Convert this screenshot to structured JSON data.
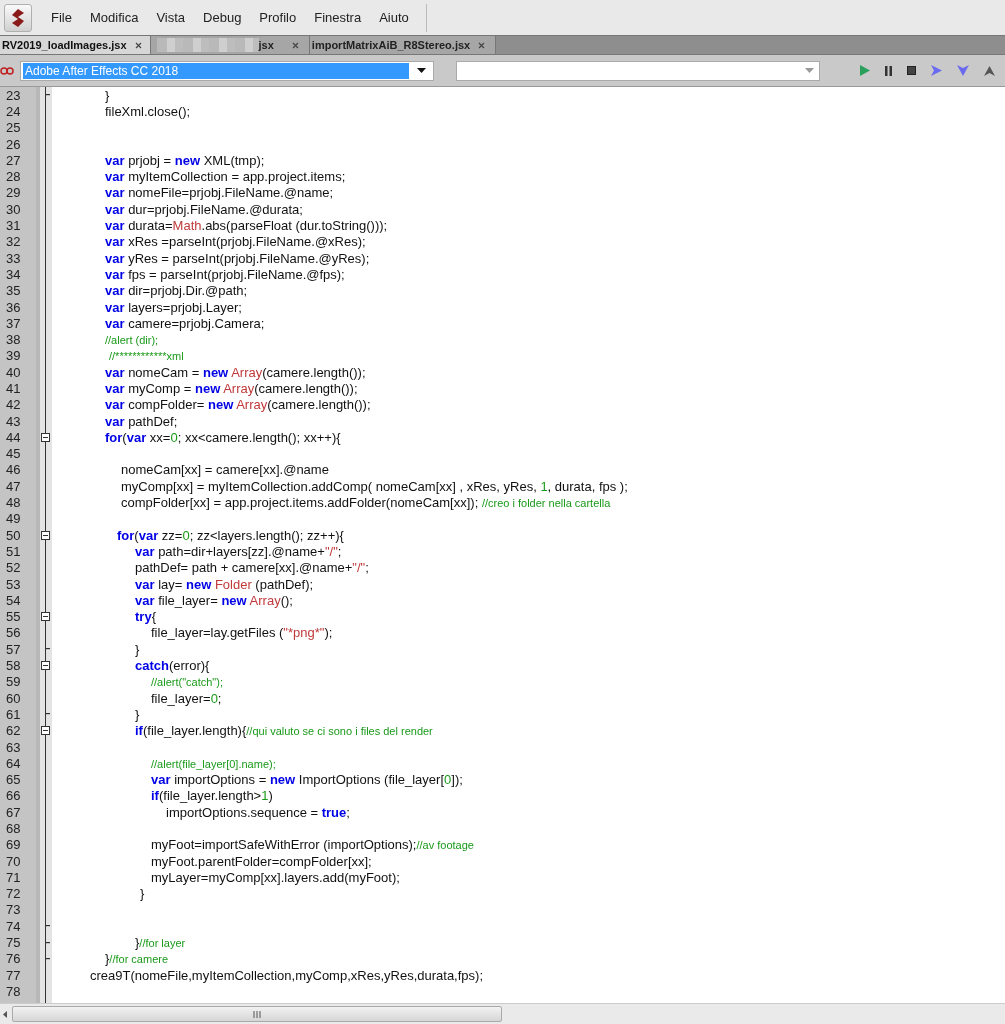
{
  "menu": [
    "File",
    "Modifica",
    "Vista",
    "Debug",
    "Profilo",
    "Finestra",
    "Aiuto"
  ],
  "tabs": [
    {
      "label": "RV2019_loadImages.jsx",
      "selected": true,
      "redacted": false
    },
    {
      "label": "jsx",
      "selected": false,
      "redacted": true
    },
    {
      "label": "importMatrixAiB_R8Stereo.jsx",
      "selected": false,
      "redacted": false
    }
  ],
  "target_select": {
    "value": "Adobe After Effects CC 2018"
  },
  "lines": [
    {
      "n": "23",
      "kind": "base",
      "collapsible": false,
      "block_end": true,
      "t": [
        {
          "kind": "p",
          "text": "}"
        }
      ]
    },
    {
      "n": "24",
      "kind": "base",
      "collapsible": false,
      "block_end": false,
      "t": [
        {
          "kind": "p",
          "text": "fileXml.close();"
        }
      ]
    },
    {
      "n": "25",
      "collapsible": false,
      "block_end": false
    },
    {
      "n": "26",
      "collapsible": false,
      "block_end": false
    },
    {
      "n": "27",
      "kind": "base",
      "collapsible": false,
      "block_end": false,
      "t": [
        {
          "kind": "kw",
          "text": "var"
        },
        {
          "kind": "p",
          "text": " prjobj = "
        },
        {
          "kind": "kw",
          "text": "new"
        },
        {
          "kind": "p",
          "text": " XML(tmp);"
        }
      ]
    },
    {
      "n": "28",
      "kind": "base",
      "collapsible": false,
      "block_end": false,
      "t": [
        {
          "kind": "kw",
          "text": "var"
        },
        {
          "kind": "p",
          "text": " myItemCollection = app.project.items;"
        }
      ]
    },
    {
      "n": "29",
      "kind": "base",
      "collapsible": false,
      "block_end": false,
      "t": [
        {
          "kind": "kw",
          "text": "var"
        },
        {
          "kind": "p",
          "text": " nomeFile=prjobj.FileName.@name;"
        }
      ]
    },
    {
      "n": "30",
      "kind": "base",
      "collapsible": false,
      "block_end": false,
      "t": [
        {
          "kind": "kw",
          "text": "var"
        },
        {
          "kind": "p",
          "text": " dur=prjobj.FileName.@durata;"
        }
      ]
    },
    {
      "n": "31",
      "kind": "base",
      "collapsible": false,
      "block_end": false,
      "t": [
        {
          "kind": "kw",
          "text": "var"
        },
        {
          "kind": "p",
          "text": " durata="
        },
        {
          "kind": "cls",
          "text": "Math"
        },
        {
          "kind": "p",
          "text": ".abs(parseFloat (dur.toString()));"
        }
      ]
    },
    {
      "n": "32",
      "kind": "base",
      "collapsible": false,
      "block_end": false,
      "t": [
        {
          "kind": "kw",
          "text": "var"
        },
        {
          "kind": "p",
          "text": " xRes =parseInt(prjobj.FileName.@xRes);"
        }
      ]
    },
    {
      "n": "33",
      "kind": "base",
      "collapsible": false,
      "block_end": false,
      "t": [
        {
          "kind": "kw",
          "text": "var"
        },
        {
          "kind": "p",
          "text": " yRes = parseInt(prjobj.FileName.@yRes);"
        }
      ]
    },
    {
      "n": "34",
      "kind": "base",
      "collapsible": false,
      "block_end": false,
      "t": [
        {
          "kind": "kw",
          "text": "var"
        },
        {
          "kind": "p",
          "text": " fps = parseInt(prjobj.FileName.@fps);"
        }
      ]
    },
    {
      "n": "35",
      "kind": "base",
      "collapsible": false,
      "block_end": false,
      "t": [
        {
          "kind": "kw",
          "text": "var"
        },
        {
          "kind": "p",
          "text": " dir=prjobj.Dir.@path;"
        }
      ]
    },
    {
      "n": "36",
      "kind": "base",
      "collapsible": false,
      "block_end": false,
      "t": [
        {
          "kind": "kw",
          "text": "var"
        },
        {
          "kind": "p",
          "text": " layers=prjobj.Layer;"
        }
      ]
    },
    {
      "n": "37",
      "kind": "base",
      "collapsible": false,
      "block_end": false,
      "t": [
        {
          "kind": "kw",
          "text": "var"
        },
        {
          "kind": "p",
          "text": " camere=prjobj.Camera;"
        }
      ]
    },
    {
      "n": "38",
      "kind": "base",
      "collapsible": false,
      "block_end": false,
      "t": [
        {
          "kind": "cm",
          "text": "//alert (dir);"
        }
      ]
    },
    {
      "n": "39",
      "kind": "baseplus",
      "collapsible": false,
      "block_end": false,
      "t": [
        {
          "kind": "cm",
          "text": "//************xml"
        }
      ]
    },
    {
      "n": "40",
      "kind": "base",
      "collapsible": false,
      "block_end": false,
      "t": [
        {
          "kind": "kw",
          "text": "var"
        },
        {
          "kind": "p",
          "text": " nomeCam = "
        },
        {
          "kind": "kw",
          "text": "new"
        },
        {
          "kind": "cls",
          "text": " Array"
        },
        {
          "kind": "p",
          "text": "(camere.length());"
        }
      ]
    },
    {
      "n": "41",
      "kind": "base",
      "collapsible": false,
      "block_end": false,
      "t": [
        {
          "kind": "kw",
          "text": "var"
        },
        {
          "kind": "p",
          "text": " myComp = "
        },
        {
          "kind": "kw",
          "text": "new"
        },
        {
          "kind": "cls",
          "text": " Array"
        },
        {
          "kind": "p",
          "text": "(camere.length());"
        }
      ]
    },
    {
      "n": "42",
      "kind": "base",
      "collapsible": false,
      "block_end": false,
      "t": [
        {
          "kind": "kw",
          "text": "var"
        },
        {
          "kind": "p",
          "text": " compFolder= "
        },
        {
          "kind": "kw",
          "text": "new"
        },
        {
          "kind": "cls",
          "text": " Array"
        },
        {
          "kind": "p",
          "text": "(camere.length());"
        }
      ]
    },
    {
      "n": "43",
      "kind": "base",
      "collapsible": false,
      "block_end": false,
      "t": [
        {
          "kind": "kw",
          "text": "var"
        },
        {
          "kind": "p",
          "text": " pathDef;"
        }
      ]
    },
    {
      "n": "44",
      "kind": "base",
      "collapsible": true,
      "block_end": false,
      "t": [
        {
          "kind": "kw",
          "text": "for"
        },
        {
          "kind": "p",
          "text": "("
        },
        {
          "kind": "kw",
          "text": "var"
        },
        {
          "kind": "p",
          "text": " xx="
        },
        {
          "kind": "num",
          "text": "0"
        },
        {
          "kind": "p",
          "text": "; xx<camere.length(); xx++){"
        }
      ]
    },
    {
      "n": "45",
      "collapsible": false,
      "block_end": false
    },
    {
      "n": "46",
      "kind": "loop",
      "collapsible": false,
      "block_end": false,
      "t": [
        {
          "kind": "p",
          "text": "nomeCam[xx] = camere[xx].@name"
        }
      ]
    },
    {
      "n": "47",
      "kind": "loop",
      "collapsible": false,
      "block_end": false,
      "t": [
        {
          "kind": "p",
          "text": "myComp[xx] = myItemCollection.addComp( nomeCam[xx] , xRes, yRes, "
        },
        {
          "kind": "num",
          "text": "1"
        },
        {
          "kind": "p",
          "text": ", durata, fps );"
        }
      ]
    },
    {
      "n": "48",
      "kind": "loop",
      "collapsible": false,
      "block_end": false,
      "t": [
        {
          "kind": "p",
          "text": "compFolder[xx] = app.project.items.addFolder(nomeCam[xx]); "
        },
        {
          "kind": "cm",
          "text": "//creo i folder nella cartella"
        }
      ]
    },
    {
      "n": "49",
      "collapsible": false,
      "block_end": false
    },
    {
      "n": "50",
      "kind": "loophead",
      "collapsible": true,
      "block_end": false,
      "t": [
        {
          "kind": "kw",
          "text": "for"
        },
        {
          "kind": "p",
          "text": "("
        },
        {
          "kind": "kw",
          "text": "var"
        },
        {
          "kind": "p",
          "text": " zz="
        },
        {
          "kind": "num",
          "text": "0"
        },
        {
          "kind": "p",
          "text": "; zz<layers.length(); zz++){"
        }
      ]
    },
    {
      "n": "51",
      "kind": "inner",
      "collapsible": false,
      "block_end": false,
      "t": [
        {
          "kind": "kw",
          "text": "var"
        },
        {
          "kind": "p",
          "text": " path=dir+layers[zz].@name+"
        },
        {
          "kind": "str",
          "text": "\"/\""
        },
        {
          "kind": "p",
          "text": ";"
        }
      ]
    },
    {
      "n": "52",
      "kind": "inner",
      "collapsible": false,
      "block_end": false,
      "t": [
        {
          "kind": "p",
          "text": "pathDef= path + camere[xx].@name+"
        },
        {
          "kind": "str",
          "text": "\"/\""
        },
        {
          "kind": "p",
          "text": ";"
        }
      ]
    },
    {
      "n": "53",
      "kind": "inner",
      "collapsible": false,
      "block_end": false,
      "t": [
        {
          "kind": "kw",
          "text": "var"
        },
        {
          "kind": "p",
          "text": " lay= "
        },
        {
          "kind": "kw",
          "text": "new"
        },
        {
          "kind": "cls",
          "text": " Folder"
        },
        {
          "kind": "p",
          "text": " (pathDef);"
        }
      ]
    },
    {
      "n": "54",
      "kind": "inner",
      "collapsible": false,
      "block_end": false,
      "t": [
        {
          "kind": "kw",
          "text": "var"
        },
        {
          "kind": "p",
          "text": " file_layer= "
        },
        {
          "kind": "kw",
          "text": "new"
        },
        {
          "kind": "cls",
          "text": " Array"
        },
        {
          "kind": "p",
          "text": "();"
        }
      ]
    },
    {
      "n": "55",
      "kind": "inner",
      "collapsible": true,
      "block_end": false,
      "t": [
        {
          "kind": "kw",
          "text": "try"
        },
        {
          "kind": "p",
          "text": "{"
        }
      ]
    },
    {
      "n": "56",
      "kind": "deep",
      "collapsible": false,
      "block_end": false,
      "t": [
        {
          "kind": "p",
          "text": "file_layer=lay.getFiles ("
        },
        {
          "kind": "str",
          "text": "\"*png*\""
        },
        {
          "kind": "p",
          "text": ");"
        }
      ]
    },
    {
      "n": "57",
      "kind": "inner",
      "collapsible": false,
      "block_end": true,
      "t": [
        {
          "kind": "p",
          "text": "}"
        }
      ]
    },
    {
      "n": "58",
      "kind": "inner",
      "collapsible": true,
      "block_end": false,
      "t": [
        {
          "kind": "kw",
          "text": "catch"
        },
        {
          "kind": "p",
          "text": "(error){"
        }
      ]
    },
    {
      "n": "59",
      "kind": "deep",
      "collapsible": false,
      "block_end": false,
      "t": [
        {
          "kind": "cm",
          "text": "//alert(\"catch\");"
        }
      ]
    },
    {
      "n": "60",
      "kind": "deep",
      "collapsible": false,
      "block_end": false,
      "t": [
        {
          "kind": "p",
          "text": "file_layer="
        },
        {
          "kind": "num",
          "text": "0"
        },
        {
          "kind": "p",
          "text": ";"
        }
      ]
    },
    {
      "n": "61",
      "kind": "inner",
      "collapsible": false,
      "block_end": true,
      "t": [
        {
          "kind": "p",
          "text": "}"
        }
      ]
    },
    {
      "n": "62",
      "kind": "inner",
      "collapsible": true,
      "block_end": false,
      "t": [
        {
          "kind": "kw",
          "text": "if"
        },
        {
          "kind": "p",
          "text": "(file_layer.length){"
        },
        {
          "kind": "cm",
          "text": "//qui valuto se ci sono i files del render"
        }
      ]
    },
    {
      "n": "63",
      "collapsible": false,
      "block_end": false
    },
    {
      "n": "64",
      "kind": "deep",
      "collapsible": false,
      "block_end": false,
      "t": [
        {
          "kind": "cm",
          "text": "//alert(file_layer[0].name);"
        }
      ]
    },
    {
      "n": "65",
      "kind": "deep",
      "collapsible": false,
      "block_end": false,
      "t": [
        {
          "kind": "kw",
          "text": "var"
        },
        {
          "kind": "p",
          "text": " importOptions = "
        },
        {
          "kind": "kw",
          "text": "new"
        },
        {
          "kind": "p",
          "text": " ImportOptions (file_layer["
        },
        {
          "kind": "num",
          "text": "0"
        },
        {
          "kind": "p",
          "text": "]);"
        }
      ]
    },
    {
      "n": "66",
      "kind": "deep",
      "collapsible": false,
      "block_end": false,
      "t": [
        {
          "kind": "kw",
          "text": "if"
        },
        {
          "kind": "p",
          "text": "(file_layer.length>"
        },
        {
          "kind": "num",
          "text": "1"
        },
        {
          "kind": "p",
          "text": ")"
        }
      ]
    },
    {
      "n": "67",
      "kind": "deepest",
      "collapsible": false,
      "block_end": false,
      "t": [
        {
          "kind": "p",
          "text": "importOptions.sequence = "
        },
        {
          "kind": "kw",
          "text": "true"
        },
        {
          "kind": "p",
          "text": ";"
        }
      ]
    },
    {
      "n": "68",
      "collapsible": false,
      "block_end": false
    },
    {
      "n": "69",
      "kind": "deep",
      "collapsible": false,
      "block_end": false,
      "t": [
        {
          "kind": "p",
          "text": "myFoot=importSafeWithError (importOptions);"
        },
        {
          "kind": "cm",
          "text": "//av footage"
        }
      ]
    },
    {
      "n": "70",
      "kind": "deep",
      "collapsible": false,
      "block_end": false,
      "t": [
        {
          "kind": "p",
          "text": "myFoot.parentFolder=compFolder[xx];"
        }
      ]
    },
    {
      "n": "71",
      "kind": "deep",
      "collapsible": false,
      "block_end": false,
      "t": [
        {
          "kind": "p",
          "text": "myLayer=myComp[xx].layers.add(myFoot);"
        }
      ]
    },
    {
      "n": "72",
      "kind": "innerplus",
      "collapsible": false,
      "block_end": false,
      "t": [
        {
          "kind": "p",
          "text": "}"
        }
      ]
    },
    {
      "n": "73",
      "collapsible": false,
      "block_end": false
    },
    {
      "n": "74",
      "collapsible": false,
      "block_end": true
    },
    {
      "n": "75",
      "kind": "inner",
      "collapsible": false,
      "block_end": true,
      "t": [
        {
          "kind": "p",
          "text": "}"
        },
        {
          "kind": "cm",
          "text": "//for layer"
        }
      ]
    },
    {
      "n": "76",
      "kind": "base",
      "collapsible": false,
      "block_end": true,
      "t": [
        {
          "kind": "p",
          "text": "}"
        },
        {
          "kind": "cm",
          "text": "//for camere"
        }
      ]
    },
    {
      "n": "77",
      "kind": "outer",
      "collapsible": false,
      "block_end": false,
      "t": [
        {
          "kind": "p",
          "text": "crea9T(nomeFile,myItemCollection,myComp,xRes,yRes,durata,fps);"
        }
      ]
    },
    {
      "n": "78",
      "collapsible": false,
      "block_end": false
    }
  ]
}
